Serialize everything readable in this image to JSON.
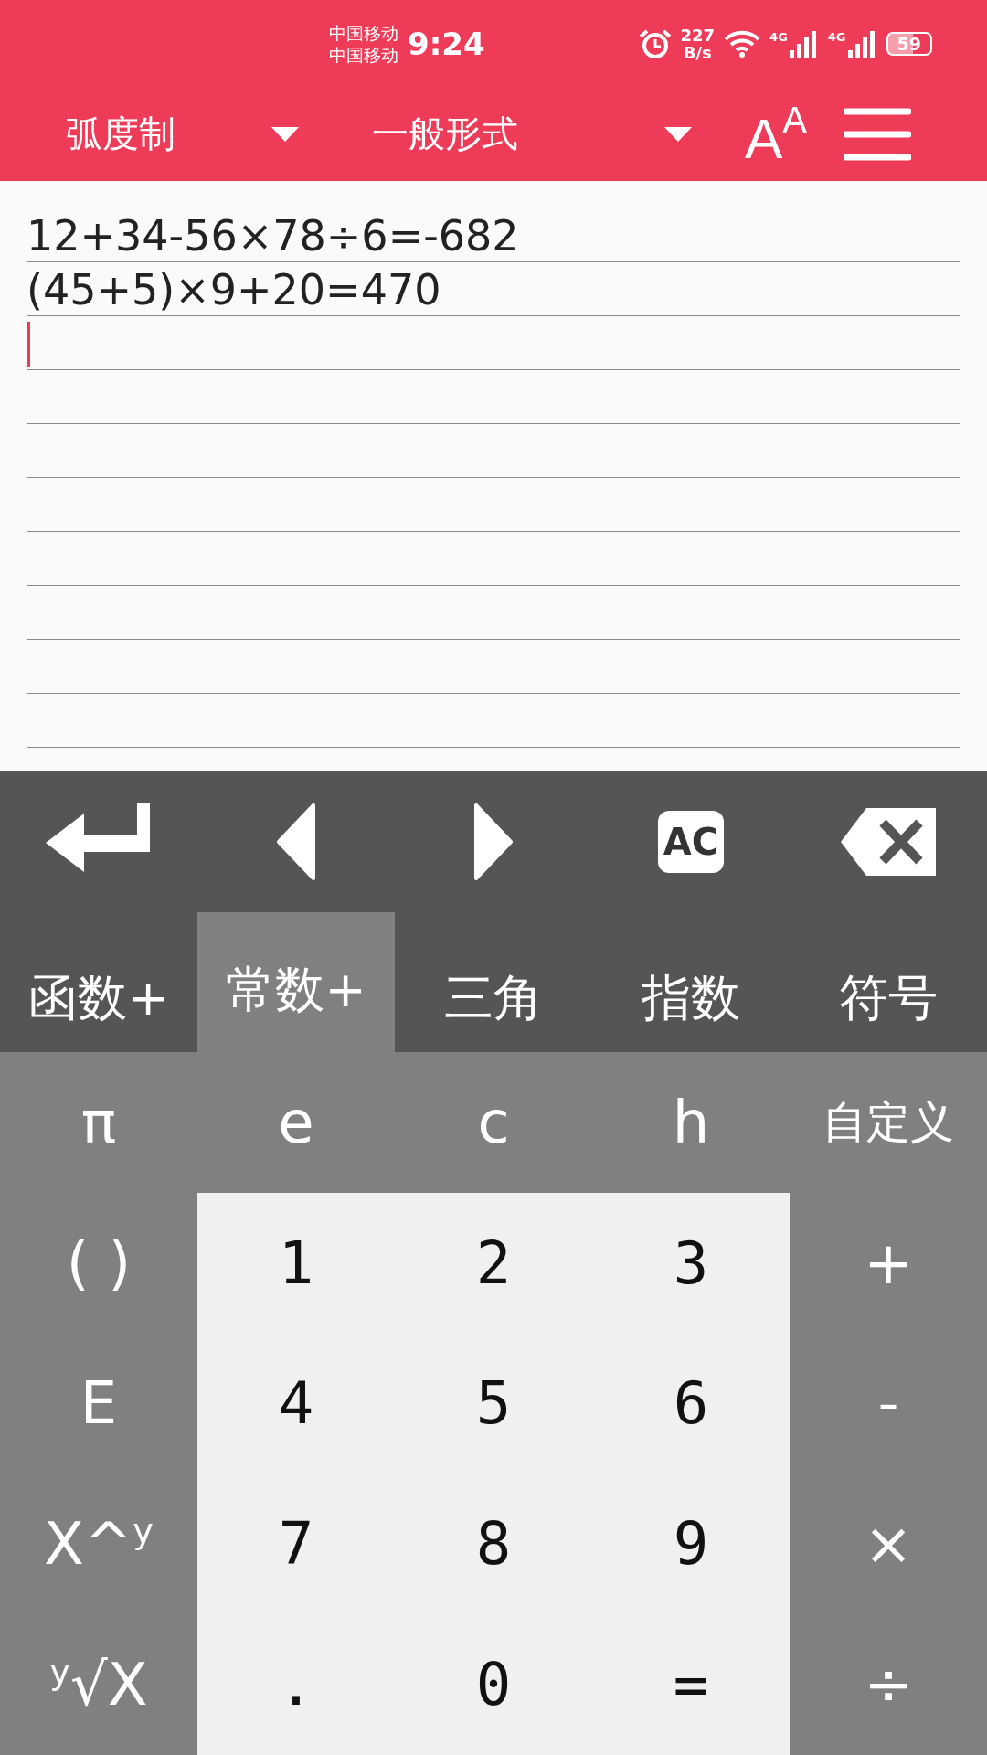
{
  "status_bar": {
    "carriers": [
      "中国移动",
      "中国移动"
    ],
    "time": "9:24",
    "speed": [
      "227",
      "B/s"
    ],
    "networks": [
      "4G",
      "4G"
    ],
    "battery": "59"
  },
  "toolbar": {
    "angle_unit": "弧度制",
    "format": "一般形式",
    "text_size_button": "A$^{A}$"
  },
  "editor": {
    "lines": [
      "12+34-56×78÷6=-682",
      "(45+5)×9+20=470"
    ]
  },
  "actions": [
    {
      "kind": "enter"
    },
    {
      "kind": "left"
    },
    {
      "kind": "right"
    },
    {
      "kind": "clear",
      "label": "AC"
    },
    {
      "kind": "backspace"
    }
  ],
  "tabs": [
    {
      "label": "函数+",
      "selected": false
    },
    {
      "label": "常数+",
      "selected": true
    },
    {
      "label": "三角",
      "selected": false
    },
    {
      "label": "指数",
      "selected": false
    },
    {
      "label": "符号",
      "selected": false
    }
  ],
  "keys": [
    [
      {
        "label": "π",
        "kind": "function"
      },
      {
        "label": "e",
        "kind": "function"
      },
      {
        "label": "c",
        "kind": "function"
      },
      {
        "label": "h",
        "kind": "function"
      },
      {
        "label": "自定义",
        "kind": "function"
      }
    ],
    [
      {
        "label": "( )",
        "kind": "function"
      },
      {
        "label": "1",
        "kind": "digit"
      },
      {
        "label": "2",
        "kind": "digit"
      },
      {
        "label": "3",
        "kind": "digit"
      },
      {
        "label": "+",
        "kind": "function"
      }
    ],
    [
      {
        "label": "E",
        "kind": "function"
      },
      {
        "label": "4",
        "kind": "digit"
      },
      {
        "label": "5",
        "kind": "digit"
      },
      {
        "label": "6",
        "kind": "digit"
      },
      {
        "label": "-",
        "kind": "function"
      }
    ],
    [
      {
        "label": "X^$^{y}$",
        "kind": "function"
      },
      {
        "label": "7",
        "kind": "digit"
      },
      {
        "label": "8",
        "kind": "digit"
      },
      {
        "label": "9",
        "kind": "digit"
      },
      {
        "label": "×",
        "kind": "function"
      }
    ],
    [
      {
        "label": "$^{y}$√X",
        "kind": "function"
      },
      {
        "label": ".",
        "kind": "digit"
      },
      {
        "label": "0",
        "kind": "digit"
      },
      {
        "label": "=",
        "kind": "digit"
      },
      {
        "label": "÷",
        "kind": "function"
      }
    ]
  ]
}
